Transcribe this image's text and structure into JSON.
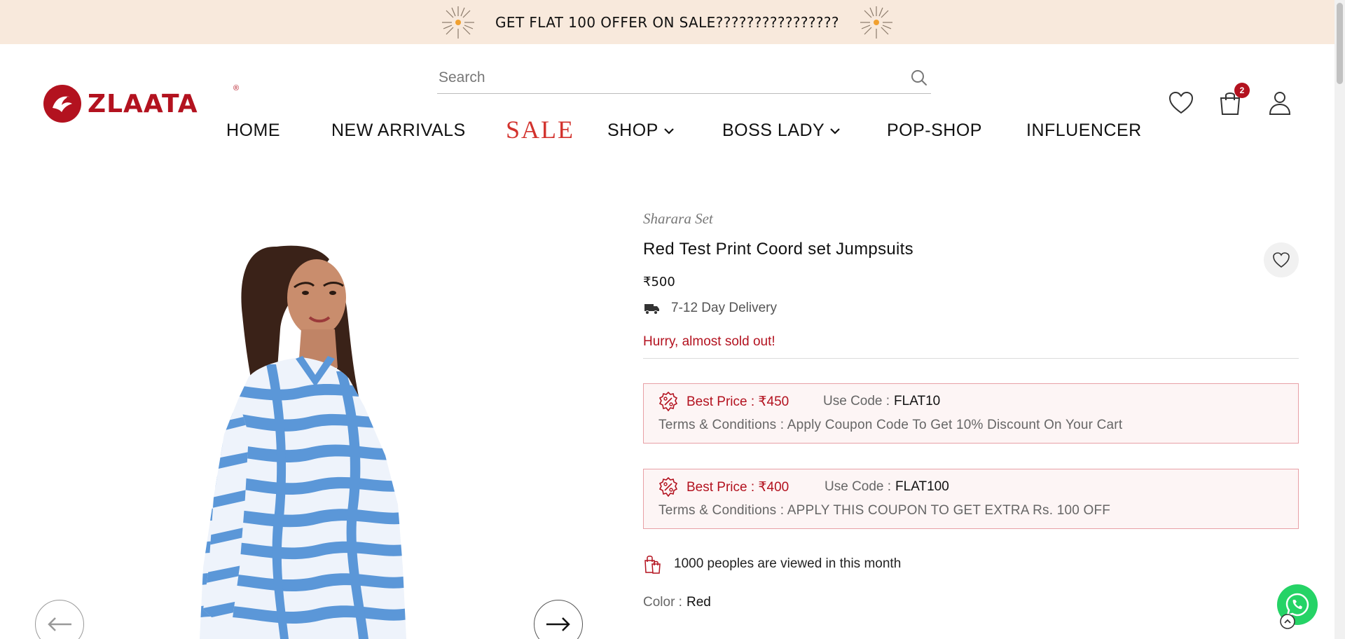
{
  "announcement": {
    "text": "GET FLAT 100 OFFER ON SALE????????????????"
  },
  "brand": {
    "name": "ZLAATA",
    "registered": "®"
  },
  "search": {
    "placeholder": "Search"
  },
  "nav": {
    "items": [
      {
        "label": "HOME"
      },
      {
        "label": "NEW ARRIVALS"
      },
      {
        "label": "SALE"
      },
      {
        "label": "SHOP"
      },
      {
        "label": "BOSS LADY"
      },
      {
        "label": "POP-SHOP"
      },
      {
        "label": "INFLUENCER"
      }
    ]
  },
  "header_icons": {
    "wishlist": "heart-icon",
    "cart": "bag-icon",
    "account": "user-icon",
    "cart_count": "2"
  },
  "product": {
    "category": "Sharara Set",
    "title": "Red Test Print Coord set Jumpsuits",
    "price": "₹500",
    "delivery": "7-12 Day Delivery",
    "stock_message": "Hurry, almost sold out!",
    "offers": [
      {
        "best_price": "Best Price : ₹450",
        "use_code_label": "Use Code :",
        "code": "FLAT10",
        "terms": "Terms & Conditions : Apply Coupon Code To Get 10% Discount On Your Cart"
      },
      {
        "best_price": "Best Price : ₹400",
        "use_code_label": "Use Code :",
        "code": "FLAT100",
        "terms": "Terms & Conditions : APPLY THIS COUPON TO GET EXTRA Rs. 100 OFF"
      }
    ],
    "views": "1000 peoples are viewed in this month",
    "color_label": "Color :",
    "color_value": "Red"
  },
  "colors": {
    "brand_red": "#b3121f",
    "announce_bg": "#f8e9dc",
    "whatsapp": "#25d366",
    "print_blue": "#5b97d8"
  }
}
